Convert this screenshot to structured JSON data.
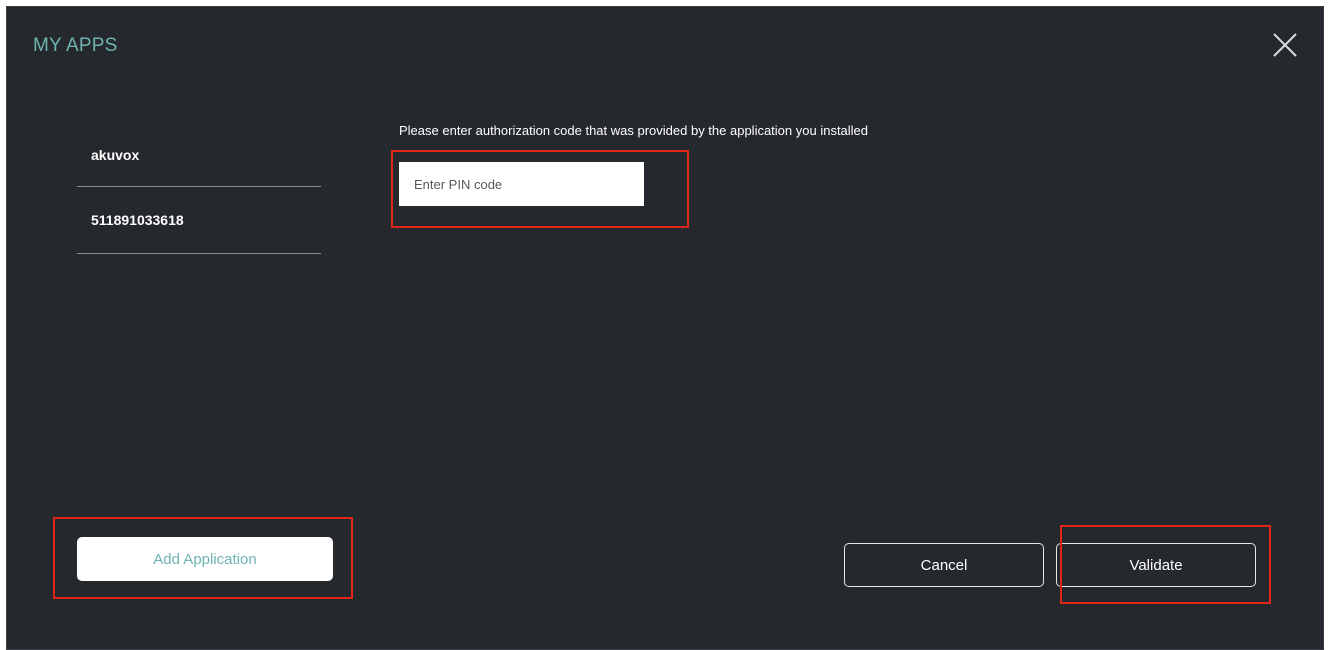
{
  "header": {
    "title": "MY APPS",
    "close_icon": "close-icon"
  },
  "sidebar": {
    "items": [
      {
        "label": "akuvox"
      },
      {
        "label": "511891033618"
      }
    ]
  },
  "main": {
    "prompt": "Please enter authorization code that was provided by the application you installed",
    "pin_input": {
      "placeholder": "Enter PIN code",
      "value": ""
    }
  },
  "footer": {
    "add_label": "Add Application",
    "cancel_label": "Cancel",
    "validate_label": "Validate"
  },
  "colors": {
    "background": "#25282d",
    "accent": "#6fb3b0",
    "highlight": "#e0251b"
  }
}
